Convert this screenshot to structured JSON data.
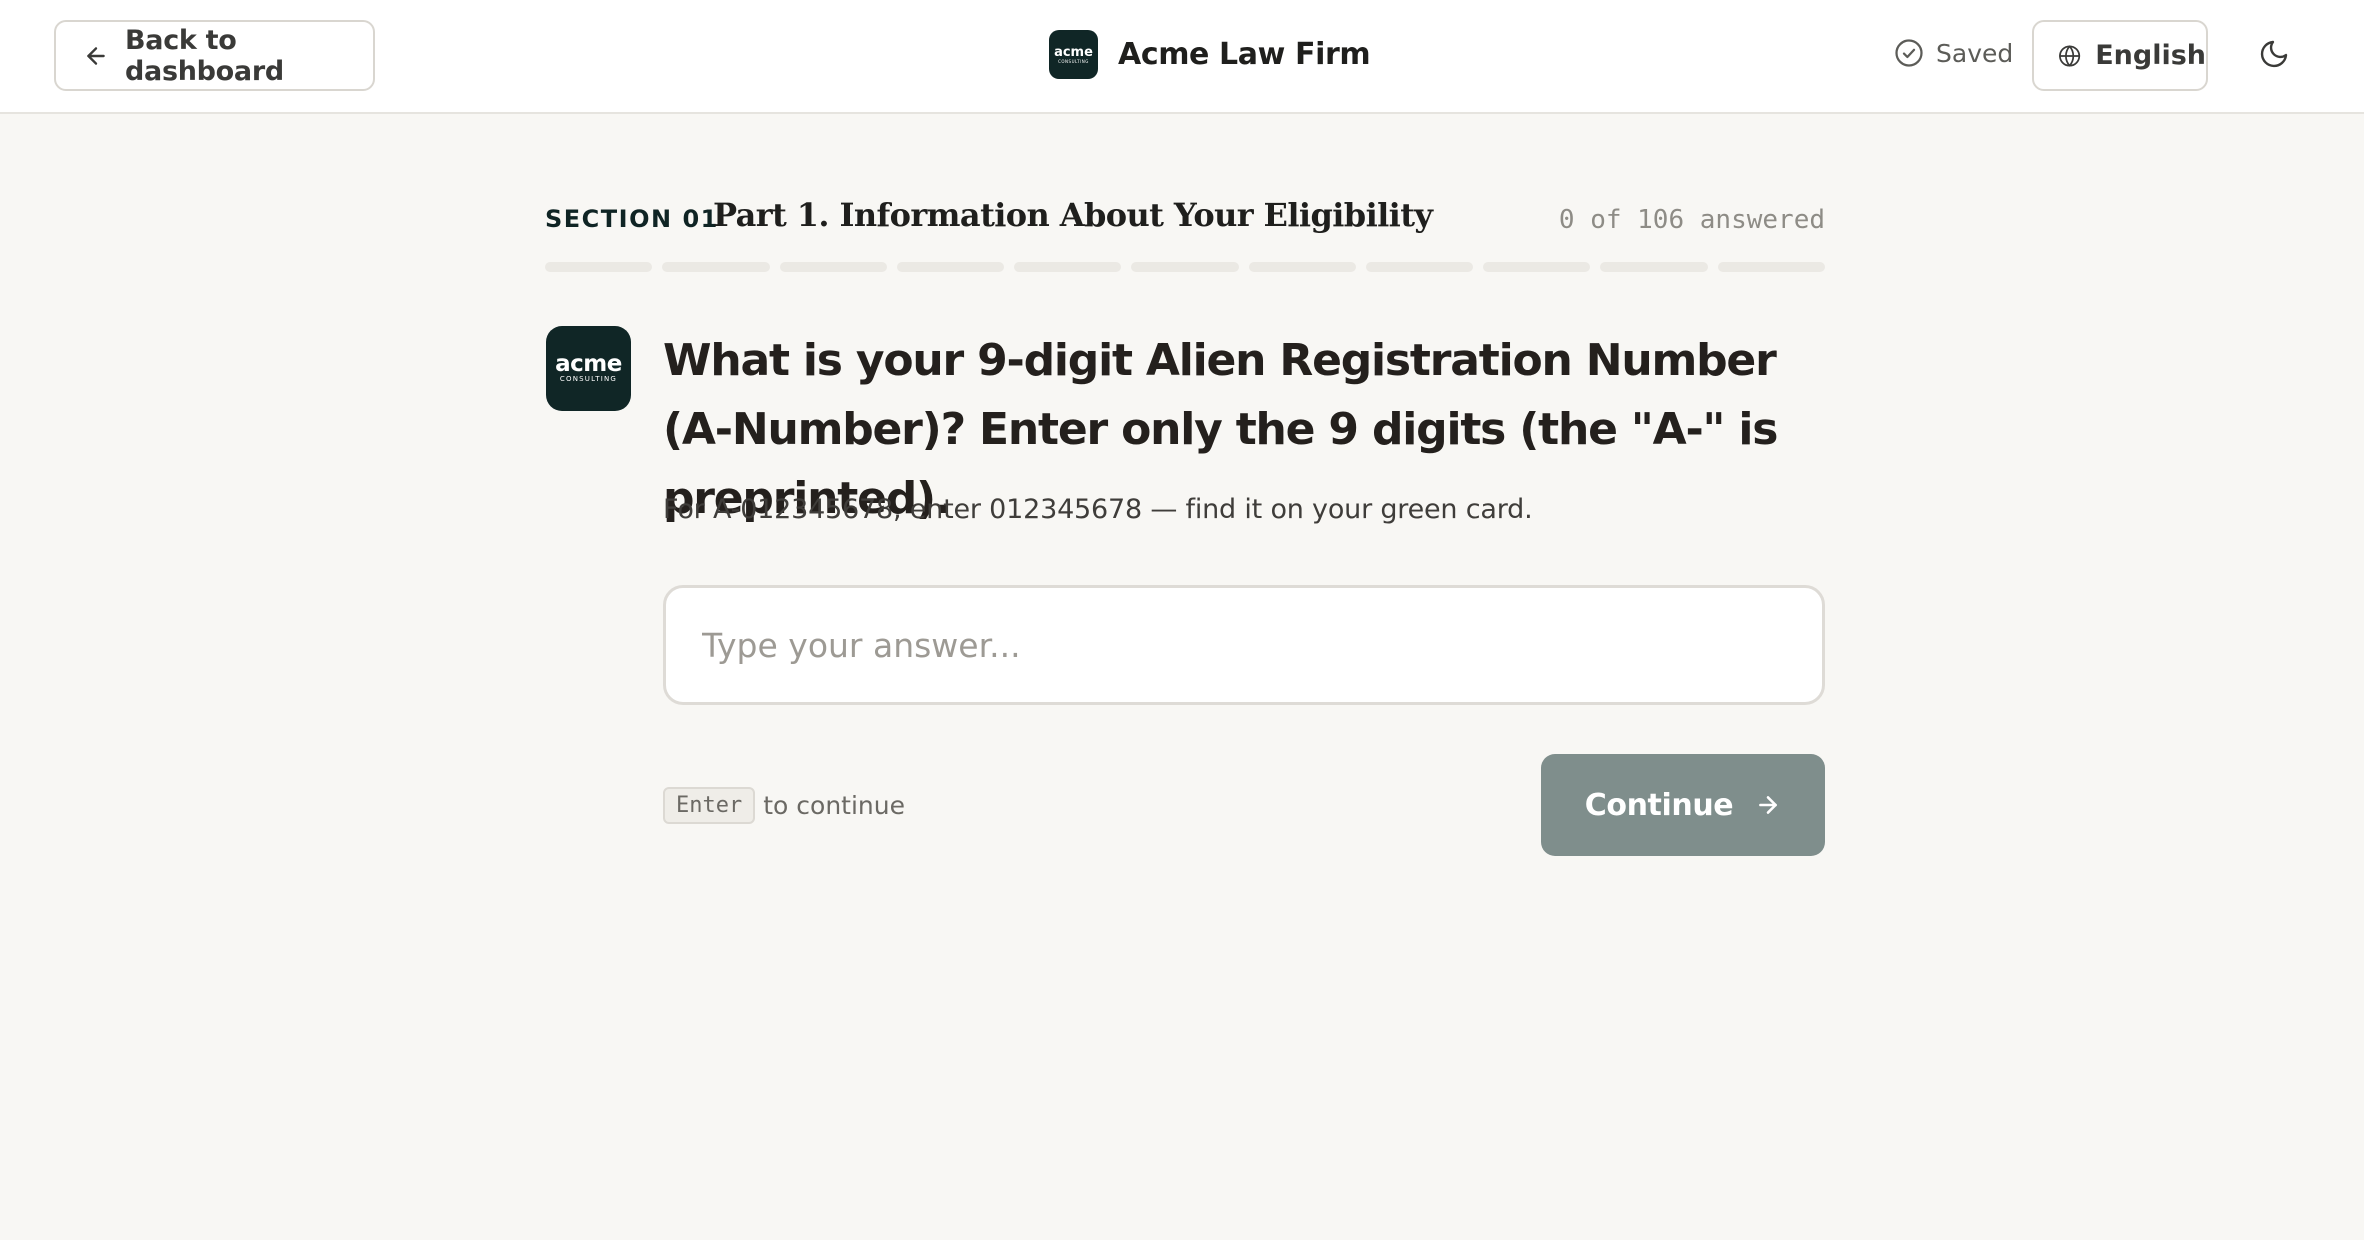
{
  "header": {
    "back_label": "Back to dashboard",
    "brand_name": "Acme Law Firm",
    "brand_logo_word": "acme",
    "brand_logo_sub": "CONSULTING",
    "saved_label": "Saved",
    "language_label": "English",
    "theme_icon": "moon-icon"
  },
  "section": {
    "label": "SECTION 01",
    "title": "Part 1. Information About Your Eligibility",
    "answered": 0,
    "total": 106,
    "progress_text": "0 of 106 answered",
    "segments": 11
  },
  "question": {
    "avatar_word": "acme",
    "avatar_sub": "CONSULTING",
    "text": "What is your 9-digit Alien Registration Number (A-Number)? Enter only the 9 digits (the \"A-\" is preprinted).",
    "hint": "For A-012345678, enter 012345678 — find it on your green card.",
    "answer_value": "",
    "answer_placeholder": "Type your answer..."
  },
  "footer": {
    "key_label": "Enter",
    "key_hint": "to continue",
    "continue_label": "Continue"
  },
  "colors": {
    "background": "#f8f7f4",
    "brand_dark": "#102626",
    "continue_button": "#7f8e8c",
    "border": "#d9d6d0"
  },
  "icons": [
    "arrow-left-icon",
    "check-circle-icon",
    "globe-icon",
    "moon-icon",
    "arrow-right-icon"
  ]
}
